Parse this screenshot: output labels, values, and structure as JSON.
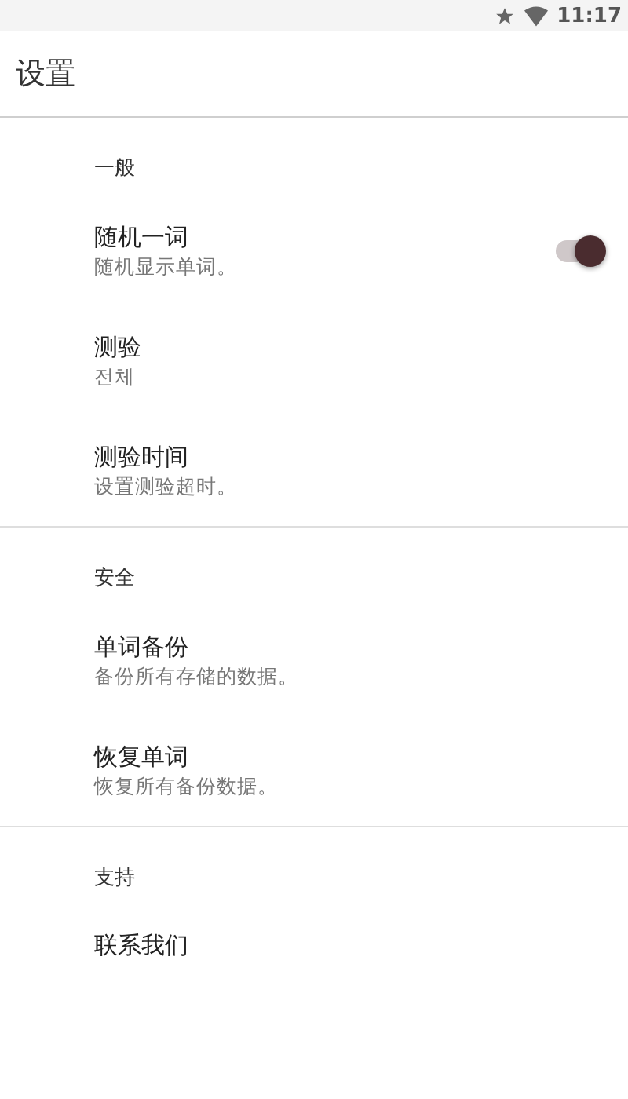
{
  "status_bar": {
    "time": "11:17"
  },
  "app_bar": {
    "title": "设置"
  },
  "sections": [
    {
      "header": "一般",
      "items": [
        {
          "kind": "switch",
          "title": "随机一词",
          "summary": "随机显示单词。",
          "on": true
        },
        {
          "kind": "plain",
          "title": "测验",
          "summary": "전체"
        },
        {
          "kind": "plain",
          "title": "测验时间",
          "summary": "设置测验超时。"
        }
      ]
    },
    {
      "header": "安全",
      "items": [
        {
          "kind": "plain",
          "title": "单词备份",
          "summary": "备份所有存储的数据。"
        },
        {
          "kind": "plain",
          "title": "恢复单词",
          "summary": "恢复所有备份数据。"
        }
      ]
    },
    {
      "header": "支持",
      "items": [
        {
          "kind": "plain",
          "title": "联系我们"
        }
      ]
    }
  ]
}
